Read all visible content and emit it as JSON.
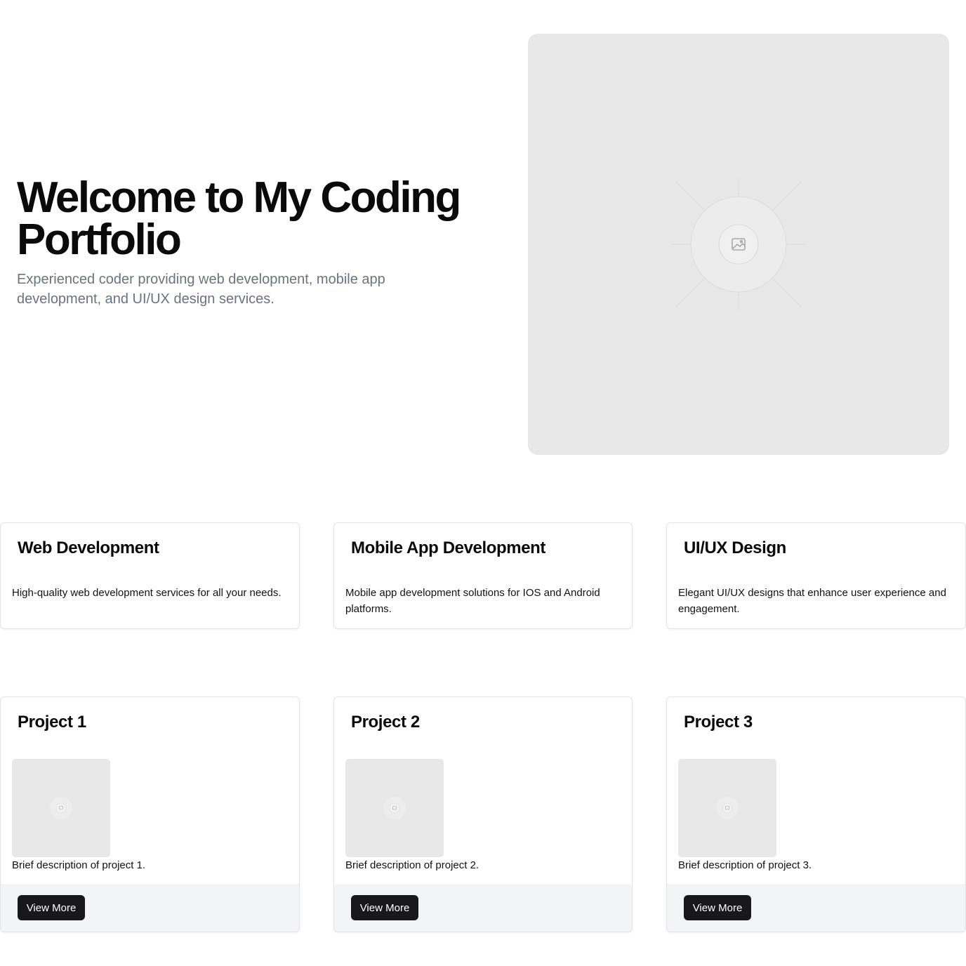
{
  "hero": {
    "title": "Welcome to My Coding Portfolio",
    "subtitle": "Experienced coder providing web development, mobile app development, and UI/UX design services.",
    "image_icon": "image-placeholder-icon"
  },
  "services": [
    {
      "title": "Web Development",
      "description": "High-quality web development services for all your needs."
    },
    {
      "title": "Mobile App Development",
      "description": "Mobile app development solutions for IOS and Android platforms."
    },
    {
      "title": "UI/UX Design",
      "description": "Elegant UI/UX designs that enhance user experience and engagement."
    }
  ],
  "projects": [
    {
      "title": "Project 1",
      "description": "Brief description of project 1.",
      "button_label": "View More"
    },
    {
      "title": "Project 2",
      "description": "Brief description of project 2.",
      "button_label": "View More"
    },
    {
      "title": "Project 3",
      "description": "Brief description of project 3.",
      "button_label": "View More"
    }
  ],
  "colors": {
    "text": "#0a0a0a",
    "muted": "#6b7280",
    "placeholder_bg": "#e8e8e8",
    "button_bg": "#18181b",
    "footer_bg": "#f3f4f6",
    "border": "#e4e4e7"
  }
}
